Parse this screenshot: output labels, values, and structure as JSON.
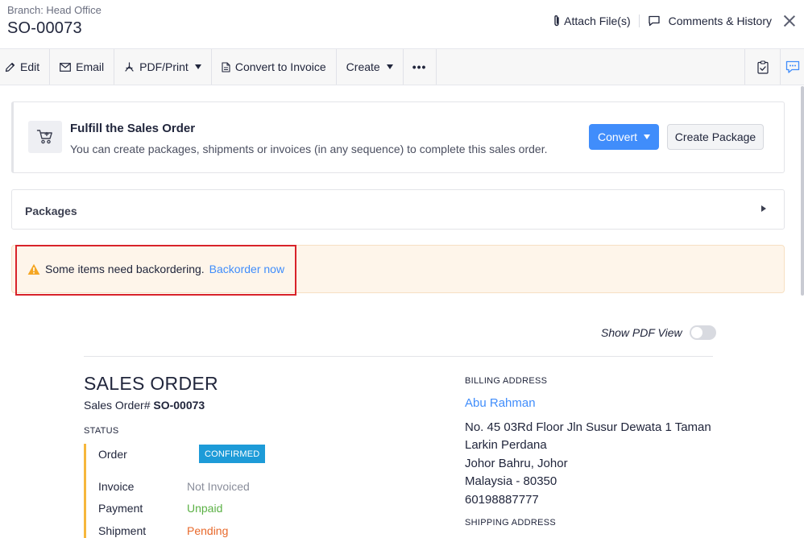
{
  "header": {
    "branch": "Branch: Head Office",
    "title": "SO-00073",
    "attach_label": "Attach File(s)",
    "comments_label": "Comments & History"
  },
  "toolbar": {
    "edit": "Edit",
    "email": "Email",
    "pdf_print": "PDF/Print",
    "convert_invoice": "Convert to Invoice",
    "create": "Create",
    "more": "•••"
  },
  "fulfill": {
    "title": "Fulfill the Sales Order",
    "description": "You can create packages, shipments or invoices (in any sequence) to complete this sales order.",
    "convert_label": "Convert",
    "create_package_label": "Create Package"
  },
  "packages": {
    "label": "Packages"
  },
  "backorder": {
    "message": "Some items need backordering.",
    "link": "Backorder now"
  },
  "pdf_view": {
    "label": "Show PDF View",
    "enabled": false
  },
  "document": {
    "title": "SALES ORDER",
    "number_label": "Sales Order#",
    "number": "SO-00073",
    "status_heading": "STATUS",
    "statuses": [
      {
        "label": "Order",
        "value": "CONFIRMED",
        "color": "#1d9bd8"
      },
      {
        "label": "Invoice",
        "value": "Not Invoiced",
        "color": "#8a8e9b"
      },
      {
        "label": "Payment",
        "value": "Unpaid",
        "color": "#5bb145"
      },
      {
        "label": "Shipment",
        "value": "Pending",
        "color": "#e8692b"
      }
    ],
    "billing": {
      "heading": "BILLING ADDRESS",
      "name": "Abu Rahman",
      "lines": [
        "No. 45 03Rd Floor Jln Susur Dewata 1 Taman",
        "Larkin Perdana",
        "Johor Bahru, Johor",
        "Malaysia - 80350",
        "60198887777"
      ]
    },
    "shipping_heading": "SHIPPING ADDRESS"
  },
  "colors": {
    "accent": "#408dfb",
    "warning_bg": "#fef5ea",
    "highlight_outline": "#d8232a",
    "status_bar": "#f6b73c"
  }
}
